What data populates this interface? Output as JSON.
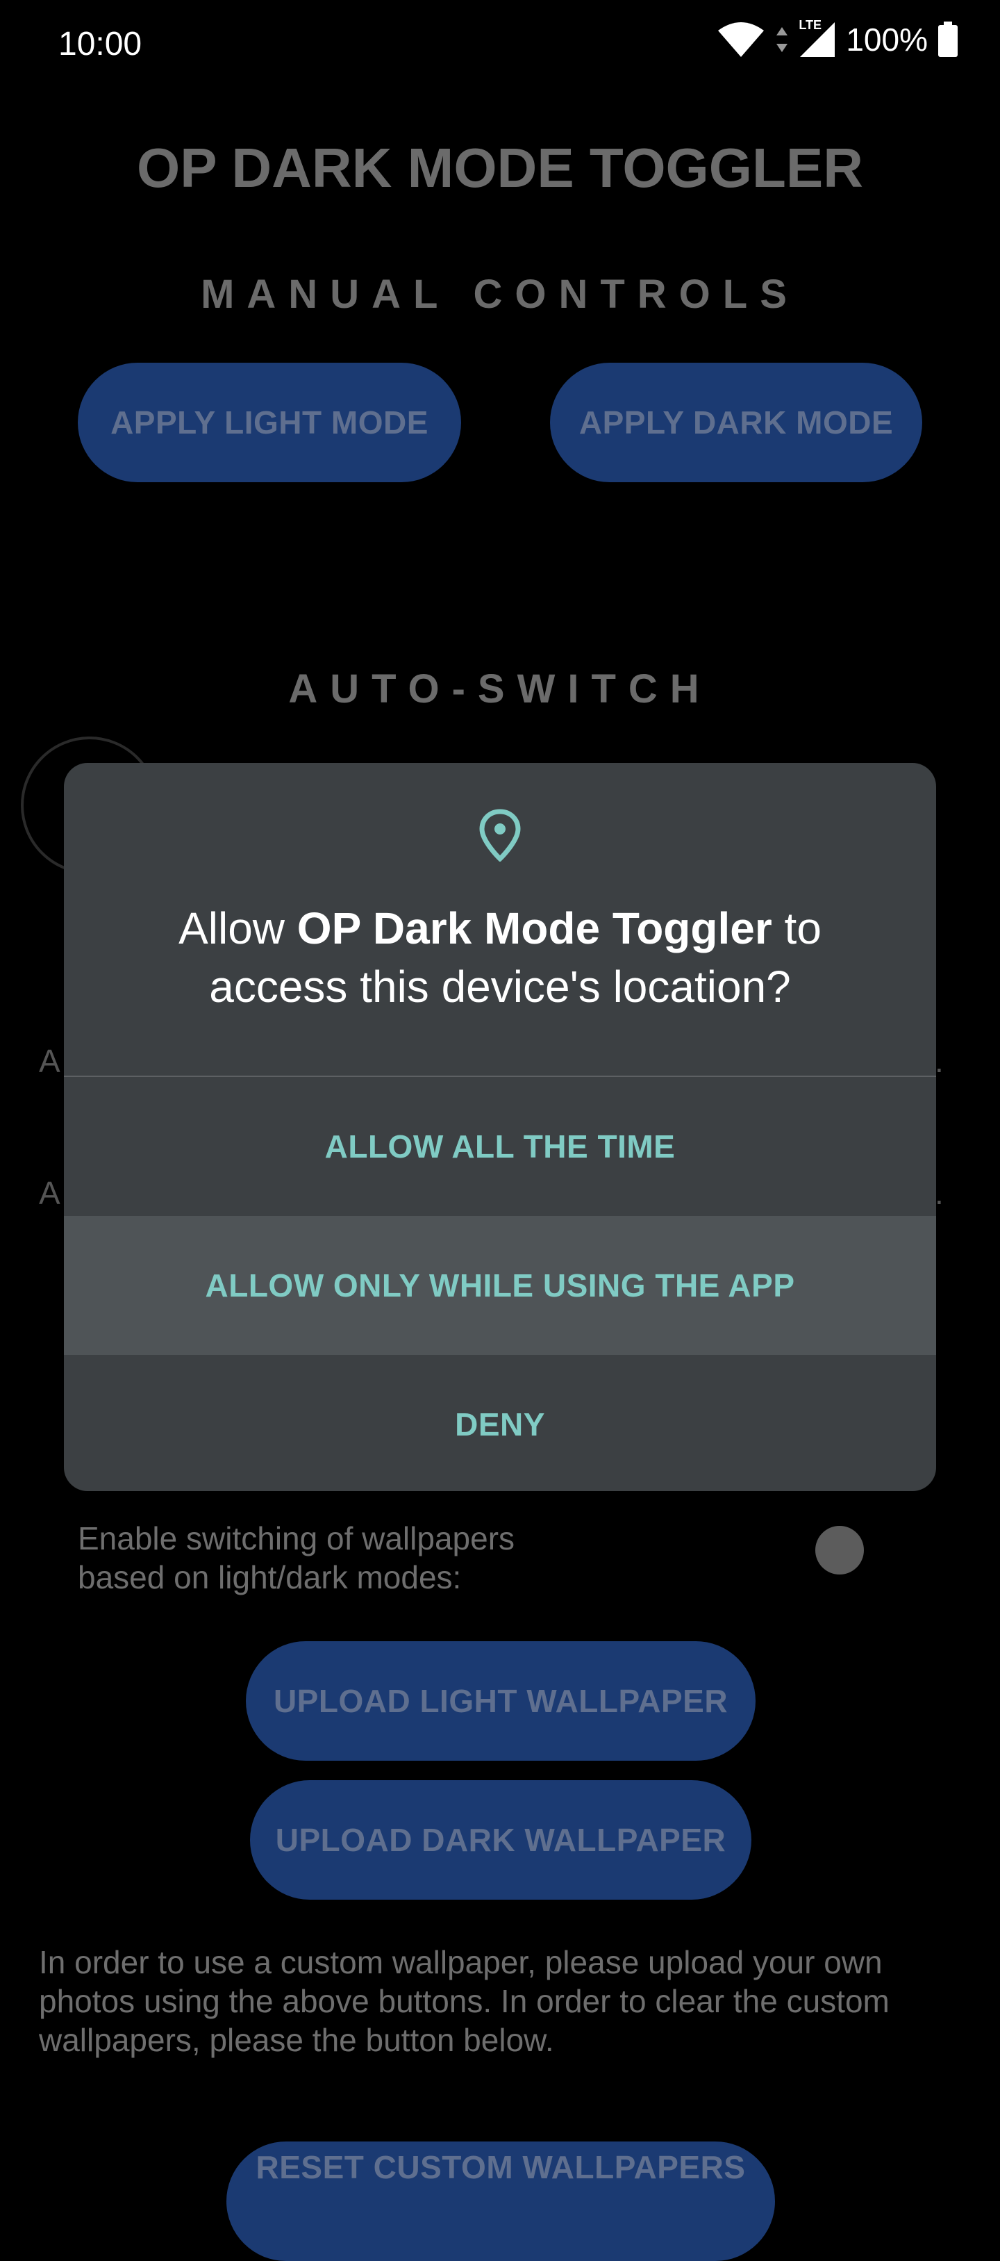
{
  "status_bar": {
    "time": "10:00",
    "network": "LTE",
    "battery_percent": "100%"
  },
  "app": {
    "title": "OP DARK MODE TOGGLER",
    "manual_controls": {
      "heading": "MANUAL CONTROLS",
      "apply_light": "APPLY LIGHT MODE",
      "apply_dark": "APPLY DARK MODE"
    },
    "auto_switch": {
      "heading": "AUTO-SWITCH",
      "row1_label_partial": "A",
      "row2_label_partial": "A"
    },
    "wallpapers": {
      "enable_label": "Enable switching of wallpapers based on light/dark modes:",
      "upload_light": "UPLOAD LIGHT WALLPAPER",
      "upload_dark": "UPLOAD DARK WALLPAPER",
      "info": "In order to use a custom wallpaper, please upload your own photos using the above buttons. In order to clear the custom wallpapers, please the button below.",
      "reset": "RESET CUSTOM WALLPAPERS"
    }
  },
  "dialog": {
    "message_prefix": "Allow ",
    "app_name": "OP Dark Mode Toggler",
    "message_suffix": " to access this device's location?",
    "options": {
      "allow_all": "ALLOW ALL THE TIME",
      "allow_while_using": "ALLOW ONLY WHILE USING THE APP",
      "deny": "DENY"
    }
  },
  "colors": {
    "dialog_bg": "#3c4043",
    "accent": "#80cbc4",
    "button_bg": "#1b3a72"
  }
}
